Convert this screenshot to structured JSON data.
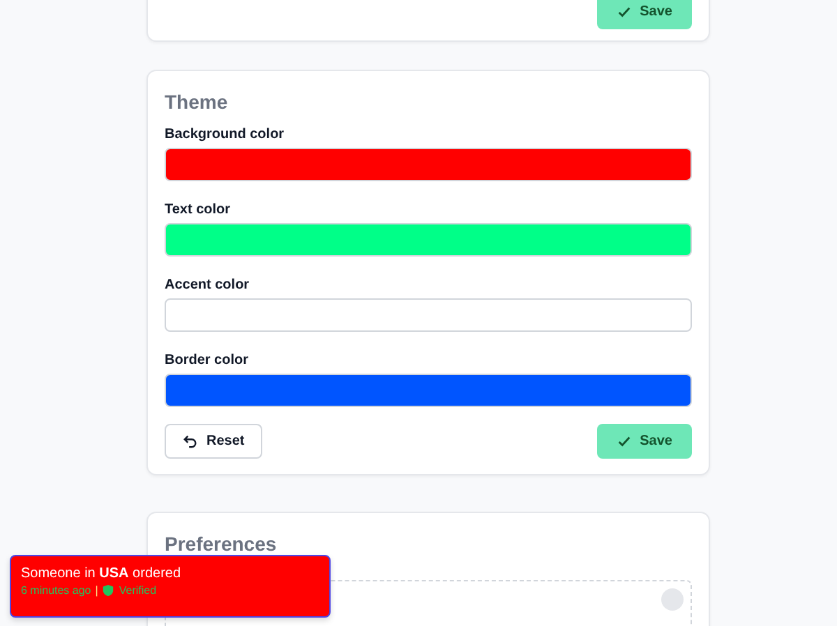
{
  "top_card": {
    "save_button": {
      "label": "Save"
    }
  },
  "theme": {
    "title": "Theme",
    "fields": [
      {
        "label": "Background color",
        "color": "#ff0000"
      },
      {
        "label": "Text color",
        "color": "#00ff88"
      },
      {
        "label": "Accent color",
        "color": "#ffffff"
      },
      {
        "label": "Border color",
        "color": "#0055ff"
      }
    ],
    "reset_button": {
      "label": "Reset"
    },
    "save_button": {
      "label": "Save"
    }
  },
  "preferences": {
    "title": "Preferences"
  },
  "toast": {
    "message": "Someone in **USA** ordered",
    "time": "6 minutes ago",
    "separator": "|",
    "badge": "Verified"
  }
}
